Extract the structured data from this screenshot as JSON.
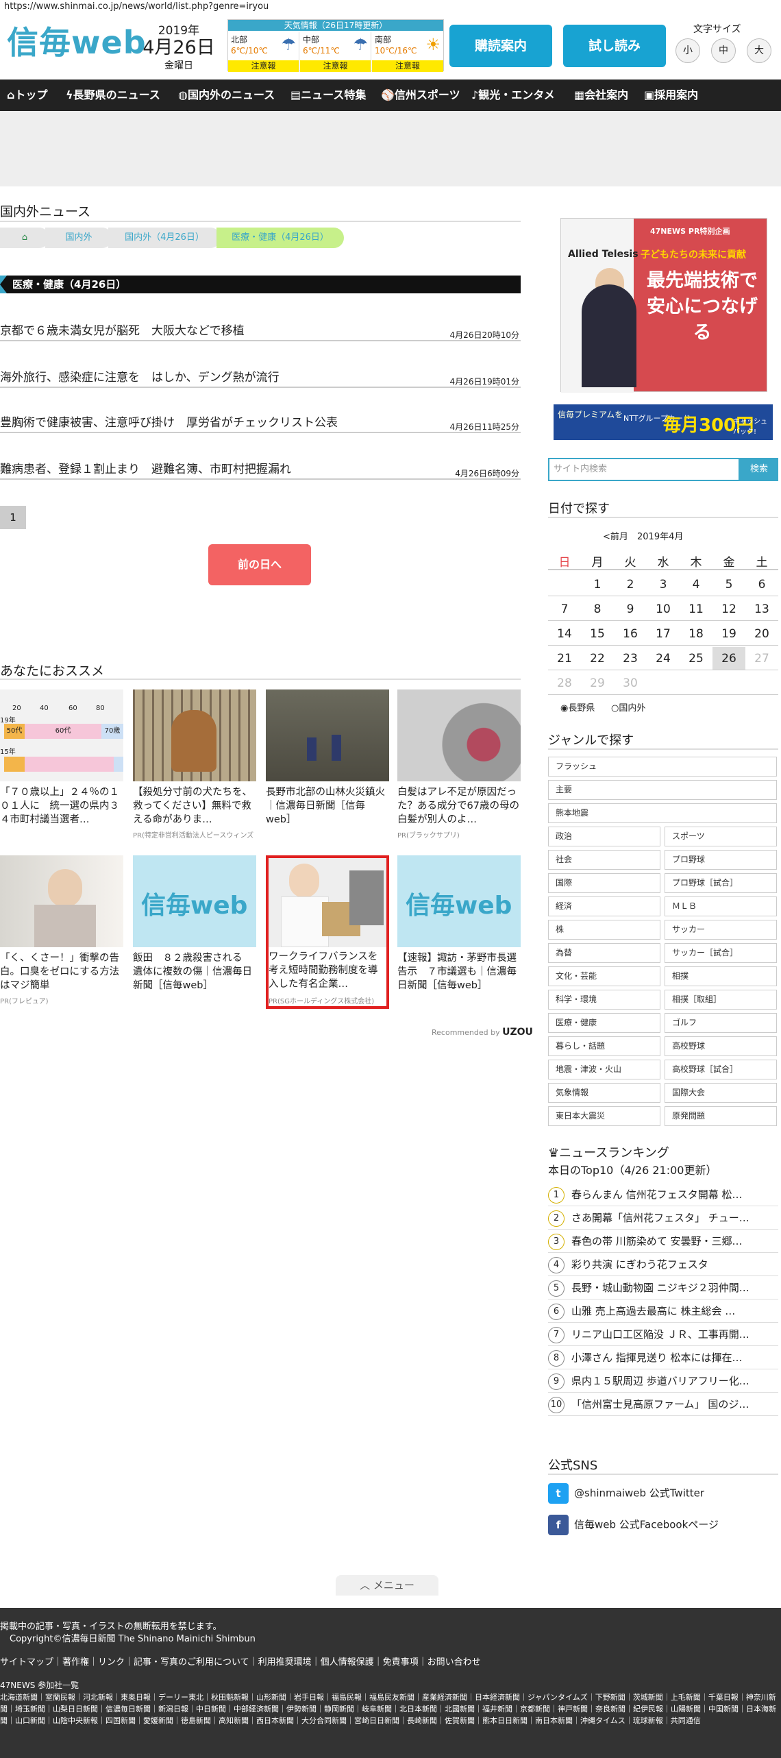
{
  "url": "https://www.shinmai.co.jp/news/world/list.php?genre=iryou",
  "logo": "信毎web",
  "date": {
    "year": "2019年",
    "day": "4月26日",
    "weekday": "金曜日"
  },
  "weather": {
    "title": "天気情報（26日17時更新）",
    "regions": [
      {
        "name": "北部",
        "temp": "6℃/10℃",
        "warn": "注意報",
        "icon": "cloud-rain-icon"
      },
      {
        "name": "中部",
        "temp": "6℃/11℃",
        "warn": "注意報",
        "icon": "cloud-rain-icon"
      },
      {
        "name": "南部",
        "temp": "10℃/16℃",
        "warn": "注意報",
        "icon": "sun-cloud-icon"
      }
    ]
  },
  "header_buttons": {
    "subscribe": "購読案内",
    "trial": "試し読み"
  },
  "font_size": {
    "title": "文字サイズ",
    "small": "小",
    "medium": "中",
    "large": "大"
  },
  "nav": [
    "トップ",
    "長野県のニュース",
    "国内外のニュース",
    "ニュース特集",
    "信州スポーツ",
    "観光・エンタメ",
    "会社案内",
    "採用案内"
  ],
  "section_title": "国内外ニュース",
  "breadcrumb": [
    "国内外",
    "国内外（4月26日）",
    "医療・健康（4月26日）"
  ],
  "category": "医療・健康（4月26日）",
  "articles": [
    {
      "title": "京都で６歳未満女児が脳死　大阪大などで移植",
      "time": "4月26日20時10分"
    },
    {
      "title": "海外旅行、感染症に注意を　はしか、デング熱が流行",
      "time": "4月26日19時01分"
    },
    {
      "title": "豊胸術で健康被害、注意呼び掛け　厚労省がチェックリスト公表",
      "time": "4月26日11時25分"
    },
    {
      "title": "難病患者、登録１割止まり　避難名簿、市町村把握漏れ",
      "time": "4月26日6時09分"
    }
  ],
  "pagination": "1",
  "prev_day": "前の日へ",
  "recommend_title": "あなたにおススメ",
  "recommend": [
    {
      "text": "「７０歳以上」２４％の１０１人に　統一選の県内３４市町村議当選者…",
      "pr": ""
    },
    {
      "text": "【殺処分寸前の犬たちを、救ってください】無料で救える命がありま…",
      "pr": "PR(特定非営利活動法人ピースウィンズ"
    },
    {
      "text": "長野市北部の山林火災鎮火｜信濃毎日新聞［信毎web］",
      "pr": ""
    },
    {
      "text": "白髪はアレ不足が原因だった？ある成分で67歳の母の白髪が別人のよ…",
      "pr": "PR(ブラックサプリ)"
    },
    {
      "text": "「く、くさー！」衝撃の告白。口臭をゼロにする方法はマジ簡単",
      "pr": "PR(フレピュア)"
    },
    {
      "text": "飯田　８２歳殺害される　遺体に複数の傷｜信濃毎日新聞［信毎web］",
      "pr": ""
    },
    {
      "text": "ワークライフバランスを考え短時間勤務制度を導入した有名企業…",
      "pr": "PR(SGホールディングス株式会社)"
    },
    {
      "text": "【速報】諏訪・茅野市長選告示　７市議選も｜信濃毎日新聞［信毎web］",
      "pr": ""
    }
  ],
  "chart_thumb": {
    "ticks": [
      "20",
      "40",
      "60",
      "80"
    ],
    "rows": [
      "19年",
      "15年"
    ],
    "labels": [
      "50代",
      "60代",
      "70歳"
    ]
  },
  "thumb_logo": "信毎web",
  "recommended_by": {
    "label": "Recommended by",
    "brand": "UZOU"
  },
  "side_ad": {
    "company": "Allied Telesis",
    "pr": "47NEWS PR特別企画",
    "sub": "子どもたちの未来に貢献",
    "main": "最先端技術で安心につなげる"
  },
  "side_ad2": {
    "left": "信毎プレミアムを",
    "mid": "NTTグループカード",
    "big": "毎月300円",
    "right": "キャッシュバック!"
  },
  "search": {
    "placeholder": "サイト内検索",
    "button": "検索"
  },
  "calendar": {
    "title": "日付で探す",
    "prev": "<前月",
    "month": "2019年4月",
    "headers": [
      "日",
      "月",
      "火",
      "水",
      "木",
      "金",
      "土"
    ],
    "rows": [
      [
        "",
        "1",
        "2",
        "3",
        "4",
        "5",
        "6"
      ],
      [
        "7",
        "8",
        "9",
        "10",
        "11",
        "12",
        "13"
      ],
      [
        "14",
        "15",
        "16",
        "17",
        "18",
        "19",
        "20"
      ],
      [
        "21",
        "22",
        "23",
        "24",
        "25",
        "26",
        "27"
      ],
      [
        "28",
        "29",
        "30",
        "",
        "",
        "",
        ""
      ]
    ],
    "selected": "26",
    "radio": [
      "長野県",
      "国内外"
    ]
  },
  "genre": {
    "title": "ジャンルで探す",
    "full": [
      "フラッシュ",
      "主要",
      "熊本地震"
    ],
    "pairs": [
      [
        "政治",
        "スポーツ"
      ],
      [
        "社会",
        "プロ野球"
      ],
      [
        "国際",
        "プロ野球［試合］"
      ],
      [
        "経済",
        "ＭＬＢ"
      ],
      [
        "株",
        "サッカー"
      ],
      [
        "為替",
        "サッカー［試合］"
      ],
      [
        "文化・芸能",
        "相撲"
      ],
      [
        "科学・環境",
        "相撲［取組］"
      ],
      [
        "医療・健康",
        "ゴルフ"
      ],
      [
        "暮らし・話題",
        "高校野球"
      ],
      [
        "地震・津波・火山",
        "高校野球［試合］"
      ],
      [
        "気象情報",
        "国際大会"
      ],
      [
        "東日本大震災",
        "原発問題"
      ]
    ]
  },
  "ranking": {
    "title": "ニュースランキング",
    "subtitle": "本日のTop10（4/26 21:00更新）",
    "items": [
      "春らんまん 信州花フェスタ開幕 松…",
      "さあ開幕「信州花フェスタ」 チュー…",
      "春色の帯 川筋染めて 安曇野・三郷…",
      "彩り共演 にぎわう花フェスタ",
      "長野・城山動物園 ニジキジ２羽仲間…",
      "山雅 売上高過去最高に 株主総会 …",
      "リニア山口工区陥没 ＪＲ、工事再開…",
      "小澤さん 指揮見送り 松本には揮在…",
      "県内１５駅周辺 歩道バリアフリー化…",
      "「信州富士見高原ファーム」 国のジ…"
    ]
  },
  "sns": {
    "title": "公式SNS",
    "twitter": "@shinmaiweb 公式Twitter",
    "facebook": "信毎web 公式Facebookページ"
  },
  "menu": "メニュー",
  "footer": {
    "notice": "掲載中の記事・写真・イラストの無断転用を禁じます。",
    "copyright": "Copyright©信濃毎日新聞 The Shinano Mainichi Shimbun",
    "links": "サイトマップ｜著作権｜リンク｜記事・写真のご利用について｜利用推奨環境｜個人情報保護｜免責事項｜お問い合わせ",
    "members_title": "47NEWS 参加社一覧",
    "members": "北海道新聞｜室蘭民報｜河北新報｜東奥日報｜デーリー東北｜秋田魁新報｜山形新聞｜岩手日報｜福島民報｜福島民友新聞｜産業経済新聞｜日本経済新聞｜ジャパンタイムズ｜下野新聞｜茨城新聞｜上毛新聞｜千葉日報｜神奈川新聞｜埼玉新聞｜山梨日日新聞｜信濃毎日新聞｜新潟日報｜中日新聞｜中部経済新聞｜伊勢新聞｜静岡新聞｜岐阜新聞｜北日本新聞｜北國新聞｜福井新聞｜京都新聞｜神戸新聞｜奈良新聞｜紀伊民報｜山陽新聞｜中国新聞｜日本海新聞｜山口新聞｜山陰中央新報｜四国新聞｜愛媛新聞｜徳島新聞｜高知新聞｜西日本新聞｜大分合同新聞｜宮崎日日新聞｜長崎新聞｜佐賀新聞｜熊本日日新聞｜南日本新聞｜沖縄タイムス｜琉球新報｜共同通信"
  },
  "colors": {
    "accent": "#3aa7c9",
    "nav": "#222222",
    "prev": "#f36363",
    "sunday": "#e5484d"
  }
}
